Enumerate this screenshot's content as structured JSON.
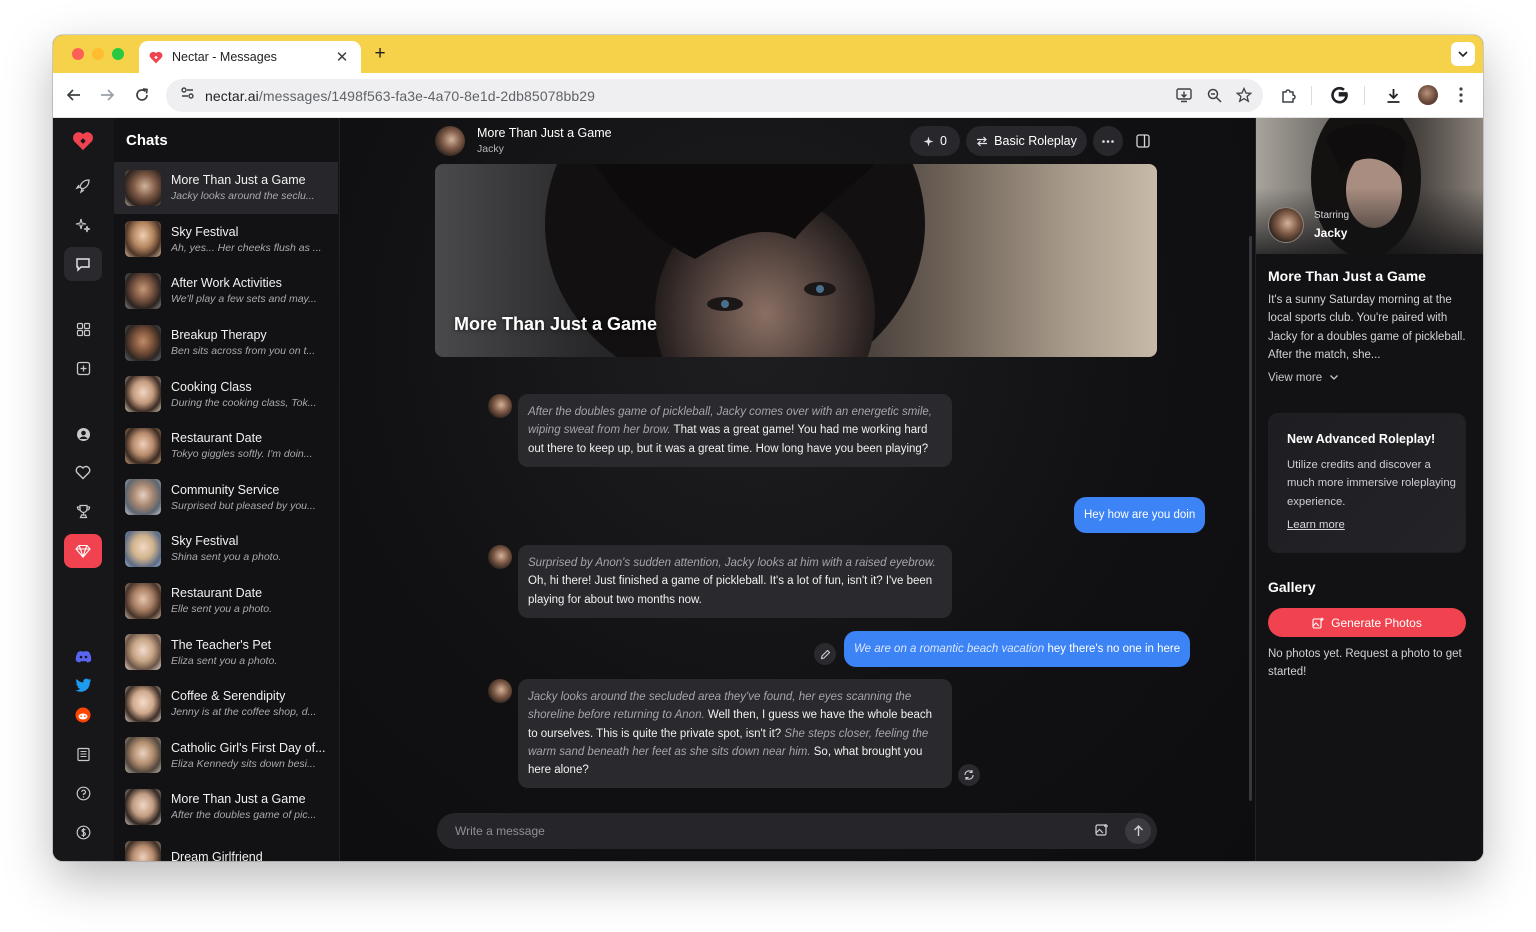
{
  "browser": {
    "tab_title": "Nectar - Messages",
    "url_host": "nectar.ai",
    "url_path": "/messages/1498f563-fa3e-4a70-8e1d-2db85078bb29",
    "accent_color": "#f6d24a"
  },
  "sidebar": {
    "brand_color": "#f0434f",
    "icons": [
      "heart-logo-icon",
      "rocket-icon",
      "sparkle-icon",
      "chat-icon",
      "grid-icon",
      "plus-square-icon",
      "user-icon",
      "heart-icon",
      "trophy-icon",
      "gem-icon",
      "discord-icon",
      "twitter-icon",
      "reddit-icon",
      "newspaper-icon",
      "help-icon",
      "dollar-icon"
    ]
  },
  "chats": {
    "title": "Chats",
    "items": [
      {
        "name": "More Than Just a Game",
        "preview": "Jacky looks around the seclu..."
      },
      {
        "name": "Sky Festival",
        "preview": "Ah, yes... Her cheeks flush as ..."
      },
      {
        "name": "After Work Activities",
        "preview": "We'll play a few sets and may..."
      },
      {
        "name": "Breakup Therapy",
        "preview": "Ben sits across from you on t..."
      },
      {
        "name": "Cooking Class",
        "preview": "During the cooking class, Tok..."
      },
      {
        "name": "Restaurant Date",
        "preview": "Tokyo giggles softly. I'm doin..."
      },
      {
        "name": "Community Service",
        "preview": "Surprised but pleased by you..."
      },
      {
        "name": "Sky Festival",
        "preview": "Shina sent you a photo."
      },
      {
        "name": "Restaurant Date",
        "preview": "Elle sent you a photo."
      },
      {
        "name": "The Teacher's Pet",
        "preview": "Eliza sent you a photo."
      },
      {
        "name": "Coffee & Serendipity",
        "preview": "Jenny is at the coffee shop, d..."
      },
      {
        "name": "Catholic Girl's First Day of...",
        "preview": "Eliza Kennedy sits down besi..."
      },
      {
        "name": "More Than Just a Game",
        "preview": "After the doubles game of pic..."
      },
      {
        "name": "Dream Girlfriend",
        "preview": ""
      }
    ]
  },
  "conversation": {
    "title": "More Than Just a Game",
    "character": "Jacky",
    "likes": "0",
    "mode": "Basic Roleplay",
    "banner_title": "More Than Just a Game",
    "messages": [
      {
        "role": "bot",
        "action": "After the doubles game of pickleball, Jacky comes over with an energetic smile, wiping sweat from her brow.",
        "text": "That was a great game! You had me working hard out there to keep up, but it was a great time. How long have you been playing?"
      },
      {
        "role": "user",
        "text": "Hey how are you doin"
      },
      {
        "role": "bot",
        "action": "Surprised by Anon's sudden attention, Jacky looks at him with a raised eyebrow.",
        "text": "Oh, hi there! Just finished a game of pickleball. It's a lot of fun, isn't it? I've been playing for about two months now."
      },
      {
        "role": "user",
        "action": "We are on a romantic beach vacation",
        "text": "hey there's no one in here"
      },
      {
        "role": "bot",
        "action": "Jacky looks around the secluded area they've found, her eyes scanning the shoreline before returning to Anon.",
        "text": "Well then, I guess we have the whole beach to ourselves. This is quite the private spot, isn't it?",
        "action2": "She steps closer, feeling the warm sand beneath her feet as she sits down near him.",
        "text2": "So, what brought you here alone?"
      }
    ],
    "composer_placeholder": "Write a message",
    "user_bubble_color": "#3c83f6"
  },
  "details": {
    "starring_label": "Starring",
    "starring_name": "Jacky",
    "title": "More Than Just a Game",
    "description": "It's a sunny Saturday morning at the local sports club. You're paired with Jacky for a doubles game of pickleball. After the match, she...",
    "view_more": "View more",
    "promo_title": "New Advanced Roleplay!",
    "promo_desc": "Utilize credits and discover a much more immersive roleplaying experience.",
    "promo_link": "Learn more",
    "gallery_title": "Gallery",
    "generate_label": "Generate Photos",
    "gallery_empty": "No photos yet. Request a photo to get started!"
  }
}
